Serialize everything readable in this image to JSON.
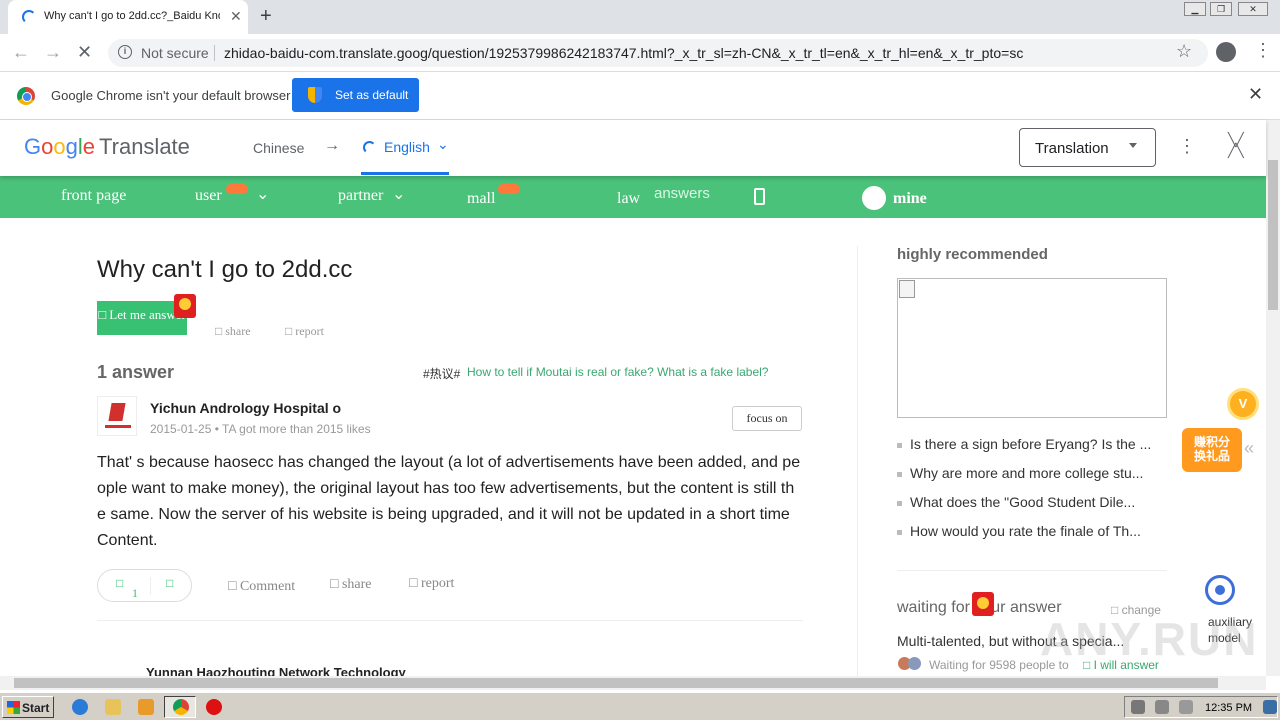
{
  "browser": {
    "tab_title": "Why can't I go to 2dd.cc?_Baidu Kno",
    "not_secure": "Not secure",
    "url": "zhidao-baidu-com.translate.goog/question/1925379986242183747.html?_x_tr_sl=zh-CN&_x_tr_tl=en&_x_tr_hl=en&_x_tr_pto=sc",
    "default_msg": "Google Chrome isn't your default browser",
    "set_default": "Set as default"
  },
  "translate_bar": {
    "logo_google": [
      "G",
      "o",
      "o",
      "g",
      "l",
      "e"
    ],
    "logo_translate": "Translate",
    "source_lang": "Chinese",
    "arrow": "→",
    "target_lang": "English",
    "mode": "Translation"
  },
  "green_nav": {
    "items": [
      "front page",
      "user",
      "partner",
      "mall",
      "law",
      "answers",
      "mine"
    ]
  },
  "question": {
    "title": "Why can't I go to 2dd.cc",
    "let_me_answer": "□ Let me answer",
    "share": "□ share",
    "report": "□ report"
  },
  "answers": {
    "count": "1 answer",
    "hot_tag": "#热议#",
    "hot_link": "How to tell if Moutai is real or fake? What is a fake label?",
    "first": {
      "name": "Yichun Andrology Hospital o",
      "meta": "2015-01-25 • TA got more than 2015 likes",
      "focus": "focus on",
      "text": "That' s because haosecc has changed the layout (a lot of advertisements have been added, and people want to make money), the original layout has too few advertisements, but the content is still the same. Now the server of his website is being upgraded, and it will not be updated in a short time Content.",
      "like_icon": "□",
      "like_count": "1",
      "dislike_icon": "□",
      "comment": "□ Comment",
      "share": "□ share",
      "report": "□ report"
    },
    "second_name": "Yunnan Haozhouting Network Technology"
  },
  "sidebar": {
    "highly_recommended": "highly recommended",
    "items": [
      "Is there a sign before Eryang? Is the ...",
      "Why are more and more college stu...",
      "What does the \"Good Student Dile...",
      "How would you rate the finale of Th..."
    ],
    "waiting_title": "waiting for your answer",
    "change": "□ change",
    "waiting_question": "Multi-talented, but without a specia...",
    "waiting_meta": "Waiting for 9598 people to",
    "will_answer": "□ I will answer"
  },
  "floating": {
    "points_v": "V",
    "points_text": "赚积分\n换礼品",
    "aux_label": "auxiliary\nmodel"
  },
  "taskbar": {
    "start": "Start",
    "clock": "12:35 PM"
  },
  "watermark": "ANY.RUN"
}
